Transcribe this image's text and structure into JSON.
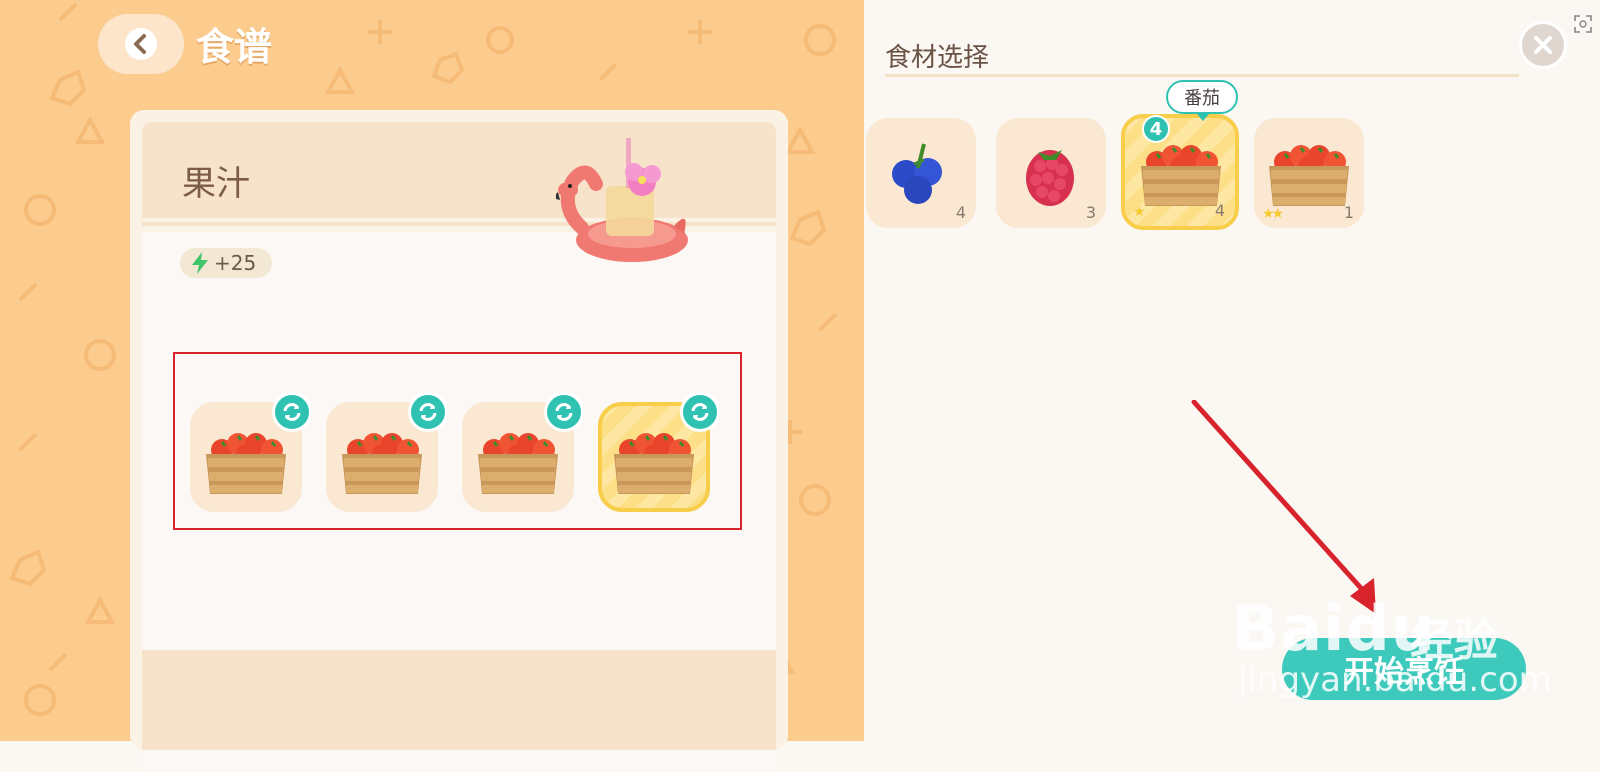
{
  "header": {
    "title": "食谱",
    "back_icon": "back-arrow-icon"
  },
  "recipe": {
    "name": "果汁",
    "energy": "+25",
    "energy_icon": "lightning-icon",
    "slots": [
      {
        "ingredient": "番茄",
        "selected": false
      },
      {
        "ingredient": "番茄",
        "selected": false
      },
      {
        "ingredient": "番茄",
        "selected": false
      },
      {
        "ingredient": "番茄",
        "selected": true
      }
    ]
  },
  "panel": {
    "title": "食材选择",
    "close_icon": "close-icon",
    "selected_badge": "4",
    "tooltip": "番茄",
    "ingredients": [
      {
        "icon": "blueberry-icon",
        "count": "4",
        "stars": "",
        "selected": false
      },
      {
        "icon": "raspberry-icon",
        "count": "3",
        "stars": "",
        "selected": false
      },
      {
        "icon": "tomato-crate-icon",
        "count": "4",
        "stars": "★",
        "selected": true
      },
      {
        "icon": "tomato-crate-icon",
        "count": "1",
        "stars": "★★",
        "selected": false
      }
    ],
    "cook_button": "开始烹饪"
  },
  "watermark": {
    "brand": "Baidu",
    "brand_cn": "经验",
    "url": "jingyan.baidu.com"
  },
  "colors": {
    "accent": "#3dcabc",
    "highlight": "#f7cd4a",
    "bg_left": "#fbcc8d",
    "annotation": "#d8232d"
  }
}
